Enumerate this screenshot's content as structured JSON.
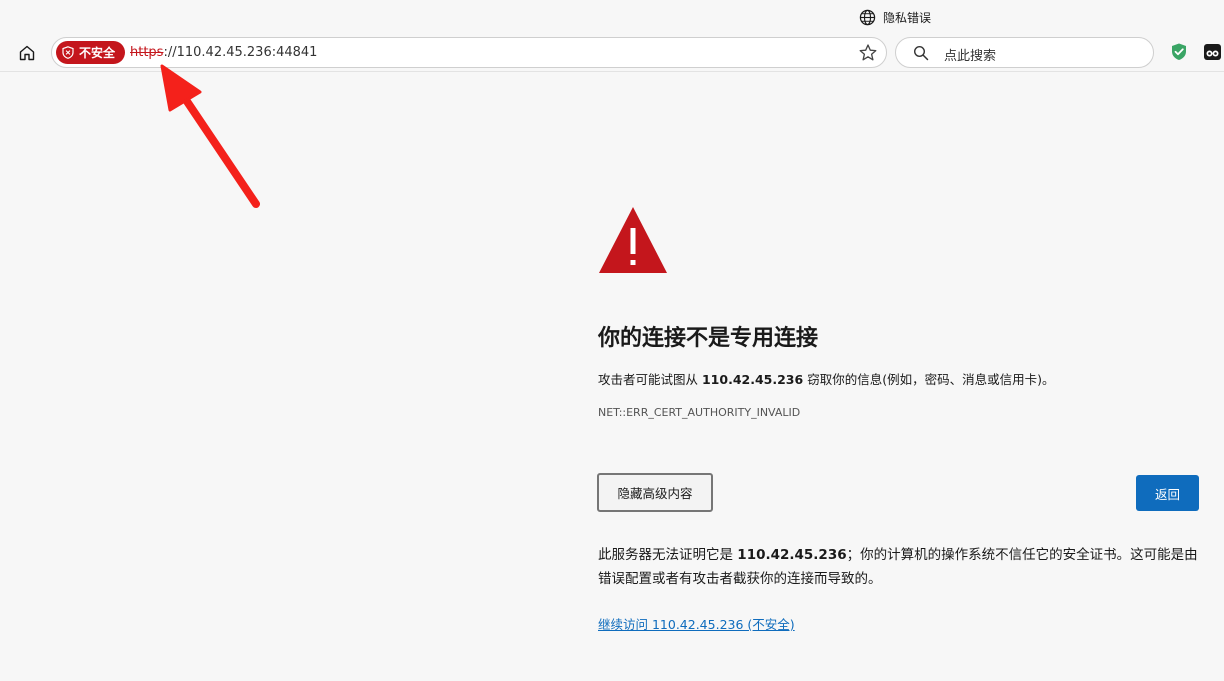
{
  "window": {
    "inprivate_label": "隐私错误"
  },
  "toolbar": {
    "security_chip": "不安全",
    "url_scheme": "https",
    "url_rest": "://110.42.45.236:44841",
    "search_placeholder": "点此搜索"
  },
  "error_page": {
    "title": "你的连接不是专用连接",
    "desc_prefix": "攻击者可能试图从 ",
    "host": "110.42.45.236",
    "desc_suffix": " 窃取你的信息(例如，密码、消息或信用卡)。",
    "error_code": "NET::ERR_CERT_AUTHORITY_INVALID",
    "details_button": "隐藏高级内容",
    "back_button": "返回",
    "explain_prefix": "此服务器无法证明它是 ",
    "explain_suffix": "；你的计算机的操作系统不信任它的安全证书。这可能是由错误配置或者有攻击者截获你的连接而导致的。",
    "proceed_link": "继续访问 110.42.45.236 (不安全)"
  },
  "colors": {
    "danger": "#c4161c",
    "accent": "#0f6cbd",
    "annotation_arrow": "#f4211b"
  },
  "icons": [
    "globe-icon",
    "home-icon",
    "shield-icon",
    "star-icon",
    "search-icon",
    "extension-shield-icon",
    "extension-mask-icon",
    "warning-triangle-icon",
    "annotation-arrow"
  ]
}
